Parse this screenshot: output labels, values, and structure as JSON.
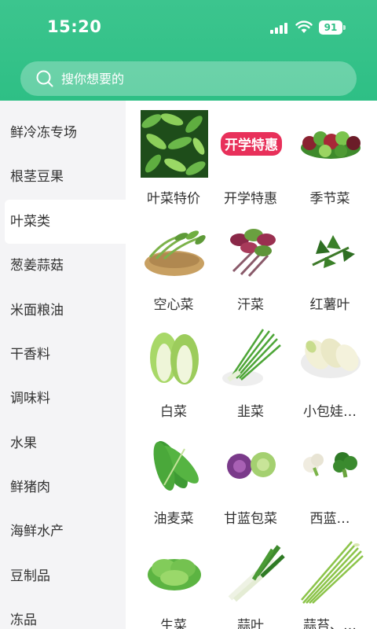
{
  "status_bar": {
    "time": "15:20",
    "battery": "91"
  },
  "search": {
    "placeholder": "搜你想要的"
  },
  "sidebar": {
    "items": [
      {
        "label": "鲜冷冻专场"
      },
      {
        "label": "根茎豆果"
      },
      {
        "label": "叶菜类"
      },
      {
        "label": "葱姜蒜菇"
      },
      {
        "label": "米面粮油"
      },
      {
        "label": "干香料"
      },
      {
        "label": "调味料"
      },
      {
        "label": "水果"
      },
      {
        "label": "鲜猪肉"
      },
      {
        "label": "海鲜水产"
      },
      {
        "label": "豆制品"
      },
      {
        "label": "冻品"
      }
    ],
    "active": "叶菜类"
  },
  "products": [
    {
      "label": "叶菜特价",
      "icon": "leafy-greens-photo"
    },
    {
      "label": "开学特惠",
      "icon": "back-to-school-promo-badge",
      "badge_text": "开学特惠"
    },
    {
      "label": "季节菜",
      "icon": "seasonal-veg-photo"
    },
    {
      "label": "空心菜",
      "icon": "water-spinach-photo"
    },
    {
      "label": "汗菜",
      "icon": "amaranth-photo"
    },
    {
      "label": "红薯叶",
      "icon": "sweet-potato-leaf-photo"
    },
    {
      "label": "白菜",
      "icon": "napa-cabbage-photo"
    },
    {
      "label": "韭菜",
      "icon": "chives-photo"
    },
    {
      "label": "小包娃…",
      "icon": "baby-cabbage-photo"
    },
    {
      "label": "油麦菜",
      "icon": "romaine-lettuce-photo"
    },
    {
      "label": "甘蓝包菜",
      "icon": "cabbage-photo"
    },
    {
      "label": "西蓝…",
      "icon": "broccoli-photo"
    },
    {
      "label": "生菜",
      "icon": "lettuce-photo"
    },
    {
      "label": "蒜叶",
      "icon": "garlic-leaf-photo"
    },
    {
      "label": "蒜苔、…",
      "icon": "garlic-scape-photo"
    }
  ],
  "colors": {
    "accent": "#2ebf85",
    "sidebar_bg": "#f4f4f6"
  }
}
